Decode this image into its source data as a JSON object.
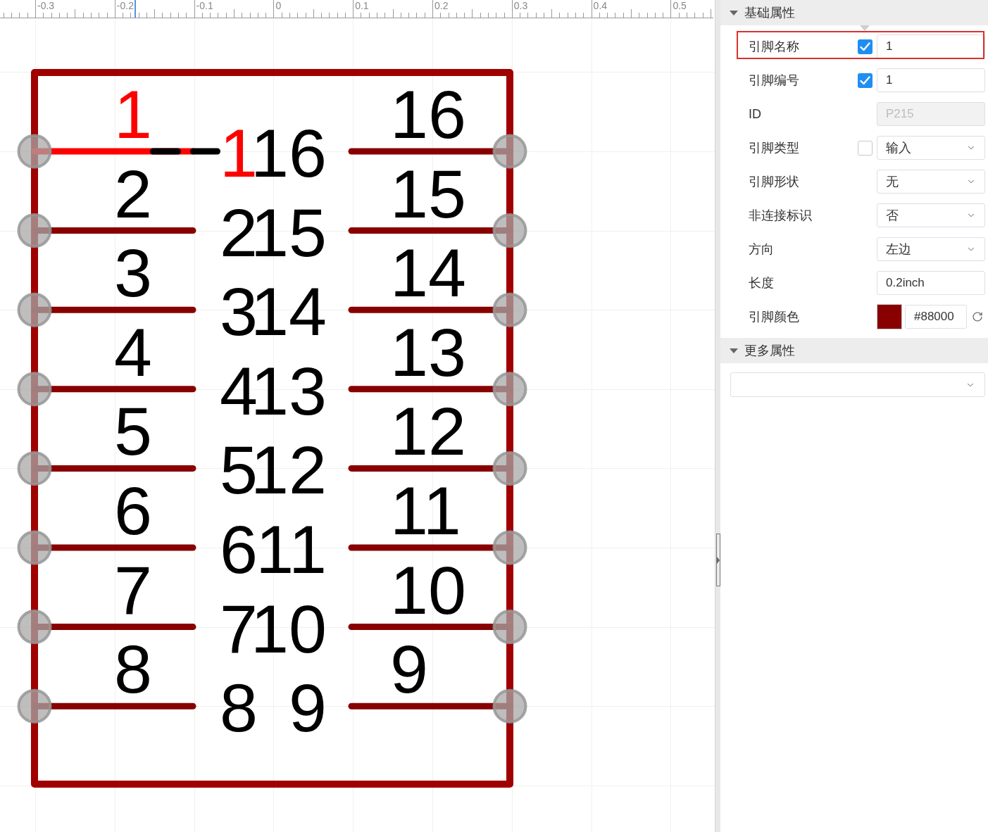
{
  "canvas": {
    "ruler": {
      "labels": [
        "-0.3",
        "-0.2",
        "-0.1",
        "0",
        "0.1",
        "0.2",
        "0.3",
        "0.4",
        "0.5"
      ]
    },
    "symbol": {
      "left_pins": [
        {
          "number": "1",
          "name": "1",
          "selected": true
        },
        {
          "number": "2",
          "name": "2",
          "selected": false
        },
        {
          "number": "3",
          "name": "3",
          "selected": false
        },
        {
          "number": "4",
          "name": "4",
          "selected": false
        },
        {
          "number": "5",
          "name": "5",
          "selected": false
        },
        {
          "number": "6",
          "name": "6",
          "selected": false
        },
        {
          "number": "7",
          "name": "7",
          "selected": false
        },
        {
          "number": "8",
          "name": "8",
          "selected": false
        }
      ],
      "right_pins": [
        {
          "number": "16",
          "name": "16",
          "selected": false
        },
        {
          "number": "15",
          "name": "15",
          "selected": false
        },
        {
          "number": "14",
          "name": "14",
          "selected": false
        },
        {
          "number": "13",
          "name": "13",
          "selected": false
        },
        {
          "number": "12",
          "name": "12",
          "selected": false
        },
        {
          "number": "11",
          "name": "11",
          "selected": false
        },
        {
          "number": "10",
          "name": "10",
          "selected": false
        },
        {
          "number": "9",
          "name": "9",
          "selected": false
        }
      ]
    }
  },
  "properties_panel": {
    "sections": [
      {
        "title": "基础属性",
        "expanded": true,
        "rows": [
          {
            "kind": "checkbox_input",
            "label": "引脚名称",
            "checked": true,
            "value": "1",
            "disabled": false,
            "highlighted": true
          },
          {
            "kind": "checkbox_input",
            "label": "引脚编号",
            "checked": true,
            "value": "1",
            "disabled": false,
            "highlighted": false
          },
          {
            "kind": "input",
            "label": "ID",
            "value": "P215",
            "disabled": true,
            "highlighted": false
          },
          {
            "kind": "checkbox_select",
            "label": "引脚类型",
            "checked": false,
            "value": "输入",
            "highlighted": false
          },
          {
            "kind": "select",
            "label": "引脚形状",
            "value": "无",
            "highlighted": false
          },
          {
            "kind": "select",
            "label": "非连接标识",
            "value": "否",
            "highlighted": false
          },
          {
            "kind": "select",
            "label": "方向",
            "value": "左边",
            "highlighted": false
          },
          {
            "kind": "input",
            "label": "长度",
            "value": "0.2inch",
            "disabled": false,
            "highlighted": false
          },
          {
            "kind": "color",
            "label": "引脚颜色",
            "color": "#880000",
            "value": "#88000",
            "highlighted": false
          }
        ]
      },
      {
        "title": "更多属性",
        "expanded": true,
        "rows": [
          {
            "kind": "wide_select"
          }
        ]
      }
    ]
  }
}
